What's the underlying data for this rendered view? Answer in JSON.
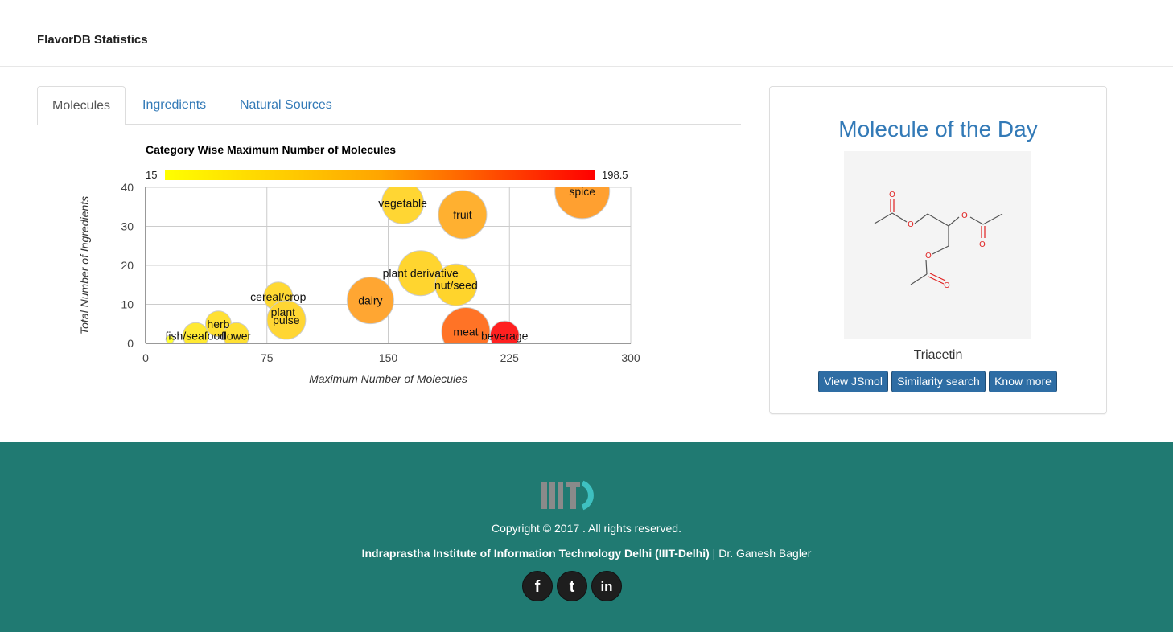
{
  "header": {
    "title": "FlavorDB Statistics"
  },
  "tabs": [
    {
      "label": "Molecules",
      "active": true
    },
    {
      "label": "Ingredients",
      "active": false
    },
    {
      "label": "Natural Sources",
      "active": false
    }
  ],
  "chart_data": {
    "type": "scatter",
    "title": "Category Wise Maximum Number of Molecules",
    "xlabel": "Maximum Number of Molecules",
    "ylabel": "Total Number of Ingredients",
    "xlim": [
      0,
      300
    ],
    "ylim": [
      0,
      40
    ],
    "xticks": [
      "0",
      "75",
      "150",
      "225",
      "300"
    ],
    "yticks": [
      "0",
      "10",
      "20",
      "30",
      "40"
    ],
    "grid": true,
    "colorscale": {
      "min": "15",
      "max": "198.5",
      "min_color": "#ffff00",
      "max_color": "#ff0000"
    },
    "points": [
      {
        "label": "spice",
        "x": 270,
        "y": 39,
        "size": 34,
        "color": "#ffa030"
      },
      {
        "label": "vegetable",
        "x": 159,
        "y": 36,
        "size": 26,
        "color": "#ffd633"
      },
      {
        "label": "fruit",
        "x": 196,
        "y": 33,
        "size": 30,
        "color": "#ffb030"
      },
      {
        "label": "plant derivative",
        "x": 170,
        "y": 18,
        "size": 28,
        "color": "#ffd52f"
      },
      {
        "label": "nut/seed",
        "x": 192,
        "y": 15,
        "size": 26,
        "color": "#ffd42c"
      },
      {
        "label": "dairy",
        "x": 139,
        "y": 11,
        "size": 29,
        "color": "#ffa632"
      },
      {
        "label": "cereal/crop",
        "x": 82,
        "y": 12,
        "size": 18,
        "color": "#ffd933"
      },
      {
        "label": "plant",
        "x": 85,
        "y": 8,
        "size": 14,
        "color": "#ffe033"
      },
      {
        "label": "pulse",
        "x": 87,
        "y": 6,
        "size": 24,
        "color": "#ffd633"
      },
      {
        "label": "meat",
        "x": 198,
        "y": 3,
        "size": 30,
        "color": "#ff7326"
      },
      {
        "label": "beverage",
        "x": 222,
        "y": 2,
        "size": 18,
        "color": "#ff2020"
      },
      {
        "label": "herb",
        "x": 45,
        "y": 5,
        "size": 16,
        "color": "#ffe033"
      },
      {
        "label": "flower",
        "x": 56,
        "y": 2,
        "size": 16,
        "color": "#ffe033"
      },
      {
        "label": "fish/seafood",
        "x": 31,
        "y": 2,
        "size": 16,
        "color": "#ffe933"
      },
      {
        "label": "",
        "x": 15,
        "y": 1,
        "size": 5,
        "color": "#ffff33"
      }
    ]
  },
  "molecule": {
    "title": "Molecule of the Day",
    "name": "Triacetin",
    "buttons": [
      "View JSmol",
      "Similarity search",
      "Know more"
    ]
  },
  "footer": {
    "copyright": "Copyright © 2017 . All rights reserved.",
    "institute": "Indraprastha Institute of Information Technology Delhi (IIIT-Delhi)",
    "separator": " | ",
    "author": "Dr. Ganesh Bagler",
    "social": [
      {
        "icon": "facebook-icon",
        "glyph": "f"
      },
      {
        "icon": "twitter-icon",
        "glyph": "t"
      },
      {
        "icon": "linkedin-icon",
        "glyph": "in"
      }
    ]
  }
}
